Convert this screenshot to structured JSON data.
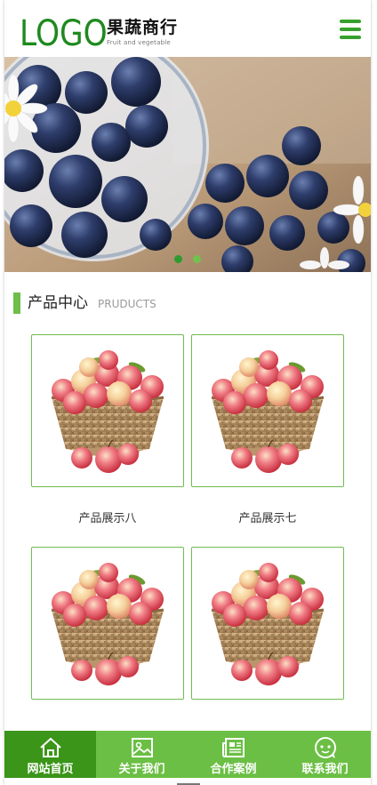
{
  "header": {
    "logo": "LOGO",
    "brand_cn": "果蔬商行",
    "brand_en": "Fruit and vegetable"
  },
  "banner": {
    "slides": 2,
    "active_index": 0
  },
  "section": {
    "title_cn": "产品中心",
    "title_en": "PRUDUCTS"
  },
  "products": [
    {
      "name": "产品展示八"
    },
    {
      "name": "产品展示七"
    },
    {
      "name": ""
    },
    {
      "name": ""
    }
  ],
  "bottom_nav": {
    "items": [
      {
        "label": "网站首页",
        "icon": "home-icon",
        "active": true
      },
      {
        "label": "关于我们",
        "icon": "image-icon",
        "active": false
      },
      {
        "label": "合作案例",
        "icon": "newspaper-icon",
        "active": false
      },
      {
        "label": "联系我们",
        "icon": "chat-icon",
        "active": false
      }
    ]
  },
  "colors": {
    "brand_green": "#1e8a1e",
    "accent_green": "#6ebe4a",
    "nav_green": "#6bbf44",
    "nav_active": "#3a9518"
  }
}
